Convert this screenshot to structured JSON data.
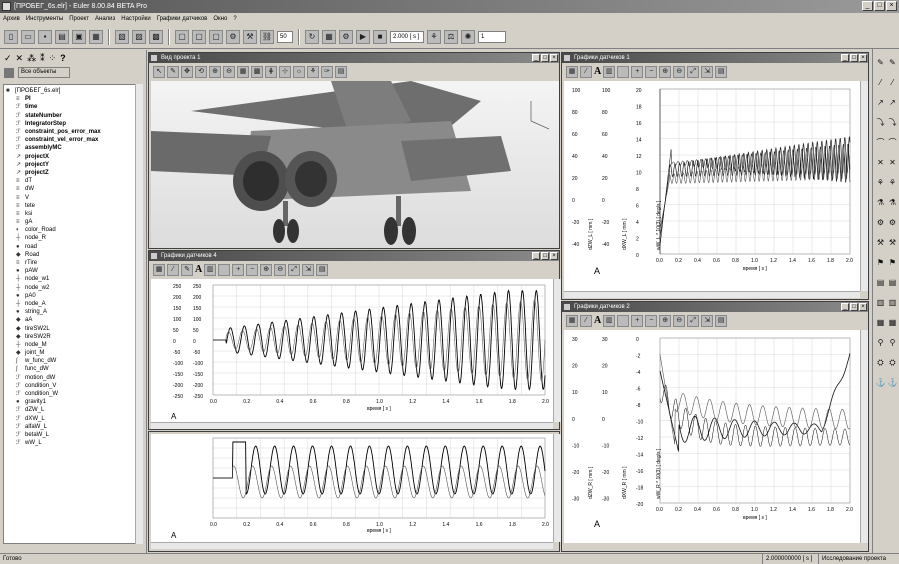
{
  "app": {
    "title": "[ПРОБЕГ_6s.elr] - Euler 8.00.84 BETA Pro"
  },
  "menu": [
    "Архив",
    "Инструменты",
    "Проект",
    "Анализ",
    "Настройки",
    "Графики датчиков",
    "Окно",
    "?"
  ],
  "toolbar": {
    "value1": "50",
    "value2": "2.000 [ s ]",
    "value3": "1"
  },
  "left": {
    "filter_label": "Все объекты",
    "combo_value": "1"
  },
  "tree": [
    {
      "label": "[ПРОБЕГ_6s.elr]",
      "bold": false,
      "icon": "root"
    },
    {
      "label": "PI",
      "bold": true,
      "icon": "const"
    },
    {
      "label": "time",
      "bold": true,
      "icon": "var"
    },
    {
      "label": "stateNumber",
      "bold": true,
      "icon": "var"
    },
    {
      "label": "IntegratorStep",
      "bold": true,
      "icon": "var"
    },
    {
      "label": "constraint_pos_error_max",
      "bold": true,
      "icon": "var"
    },
    {
      "label": "constraint_vel_error_max",
      "bold": true,
      "icon": "var"
    },
    {
      "label": "assemblyMC",
      "bold": true,
      "icon": "var"
    },
    {
      "label": "projectX",
      "bold": true,
      "icon": "vec"
    },
    {
      "label": "projectY",
      "bold": true,
      "icon": "vec"
    },
    {
      "label": "projectZ",
      "bold": true,
      "icon": "vec"
    },
    {
      "label": "dT",
      "bold": false,
      "icon": "const"
    },
    {
      "label": "dW",
      "bold": false,
      "icon": "const"
    },
    {
      "label": "V",
      "bold": false,
      "icon": "const"
    },
    {
      "label": "tete",
      "bold": false,
      "icon": "const"
    },
    {
      "label": "ksi",
      "bold": false,
      "icon": "const"
    },
    {
      "label": "gA",
      "bold": false,
      "icon": "const"
    },
    {
      "label": "color_Road",
      "bold": false,
      "icon": "color"
    },
    {
      "label": "node_R",
      "bold": false,
      "icon": "node"
    },
    {
      "label": "road",
      "bold": false,
      "icon": "obj"
    },
    {
      "label": "Road",
      "bold": false,
      "icon": "body"
    },
    {
      "label": "rTire",
      "bold": false,
      "icon": "const"
    },
    {
      "label": "pAW",
      "bold": false,
      "icon": "obj"
    },
    {
      "label": "node_w1",
      "bold": false,
      "icon": "node"
    },
    {
      "label": "node_w2",
      "bold": false,
      "icon": "node"
    },
    {
      "label": "pA0",
      "bold": false,
      "icon": "obj"
    },
    {
      "label": "node_A",
      "bold": false,
      "icon": "node"
    },
    {
      "label": "string_A",
      "bold": false,
      "icon": "obj"
    },
    {
      "label": "aA",
      "bold": false,
      "icon": "body"
    },
    {
      "label": "tireSW2L",
      "bold": false,
      "icon": "body"
    },
    {
      "label": "tireSW2R",
      "bold": false,
      "icon": "body"
    },
    {
      "label": "node_M",
      "bold": false,
      "icon": "node"
    },
    {
      "label": "joint_M",
      "bold": false,
      "icon": "body"
    },
    {
      "label": "w_func_dW",
      "bold": false,
      "icon": "func"
    },
    {
      "label": "func_dW",
      "bold": false,
      "icon": "func"
    },
    {
      "label": "motion_dW",
      "bold": false,
      "icon": "var"
    },
    {
      "label": "condition_V",
      "bold": false,
      "icon": "var"
    },
    {
      "label": "condition_W",
      "bold": false,
      "icon": "var"
    },
    {
      "label": "gravity1",
      "bold": false,
      "icon": "obj"
    },
    {
      "label": "dZW_L",
      "bold": false,
      "icon": "var"
    },
    {
      "label": "dXW_L",
      "bold": false,
      "icon": "var"
    },
    {
      "label": "alfaW_L",
      "bold": false,
      "icon": "var"
    },
    {
      "label": "betaW_L",
      "bold": false,
      "icon": "var"
    },
    {
      "label": "wW_L",
      "bold": false,
      "icon": "var"
    }
  ],
  "win_view": {
    "title": "Вид проекта 1"
  },
  "win_g4": {
    "title": "Графики датчиков 4",
    "xlabel": "время [ s ]",
    "a_label": "A"
  },
  "win_g1": {
    "title": "Графики датчиков 1",
    "xlabel": "время [ s ]",
    "a_label": "A",
    "y_labels": [
      "dZW_L [ mm ]",
      "dXW_L [ mm ]",
      "wW_L * 10(3) [ deg/s ]"
    ],
    "y_ticks": [
      "100",
      "80",
      "60",
      "40",
      "20",
      "0",
      "-20",
      "-40"
    ],
    "y_ticks2": [
      "100",
      "80",
      "60",
      "40",
      "20",
      "0",
      "-20",
      "-40"
    ],
    "y_ticks3": [
      "20",
      "18",
      "16",
      "14",
      "12",
      "10",
      "8",
      "6",
      "4",
      "2",
      "0"
    ],
    "x_ticks": [
      "0.0",
      "0.2",
      "0.4",
      "0.6",
      "0.8",
      "1.0",
      "1.2",
      "1.4",
      "1.6",
      "1.8",
      "2.0"
    ]
  },
  "win_g2": {
    "title": "Графики датчиков 2",
    "xlabel": "время [ s ]",
    "a_label": "A",
    "y_labels": [
      "dZW_R [ mm ]",
      "dXW_R [ mm ]",
      "wW_R * 10(3) [ deg/s ]"
    ],
    "y_ticks": [
      "30",
      "20",
      "10",
      "0",
      "-10",
      "-20",
      "-30"
    ],
    "y_ticks2": [
      "30",
      "20",
      "10",
      "0",
      "-10",
      "-20",
      "-30"
    ],
    "y_ticks3": [
      "0",
      "-2",
      "-4",
      "-6",
      "-8",
      "-10",
      "-12",
      "-14",
      "-16",
      "-18",
      "-20"
    ],
    "x_ticks": [
      "0.0",
      "0.2",
      "0.4",
      "0.6",
      "0.8",
      "1.0",
      "1.2",
      "1.4",
      "1.6",
      "1.8",
      "2.0"
    ]
  },
  "status": {
    "ready": "Готово",
    "time": "2.000000000 [ s ]",
    "mode": "Исследование проекта"
  }
}
